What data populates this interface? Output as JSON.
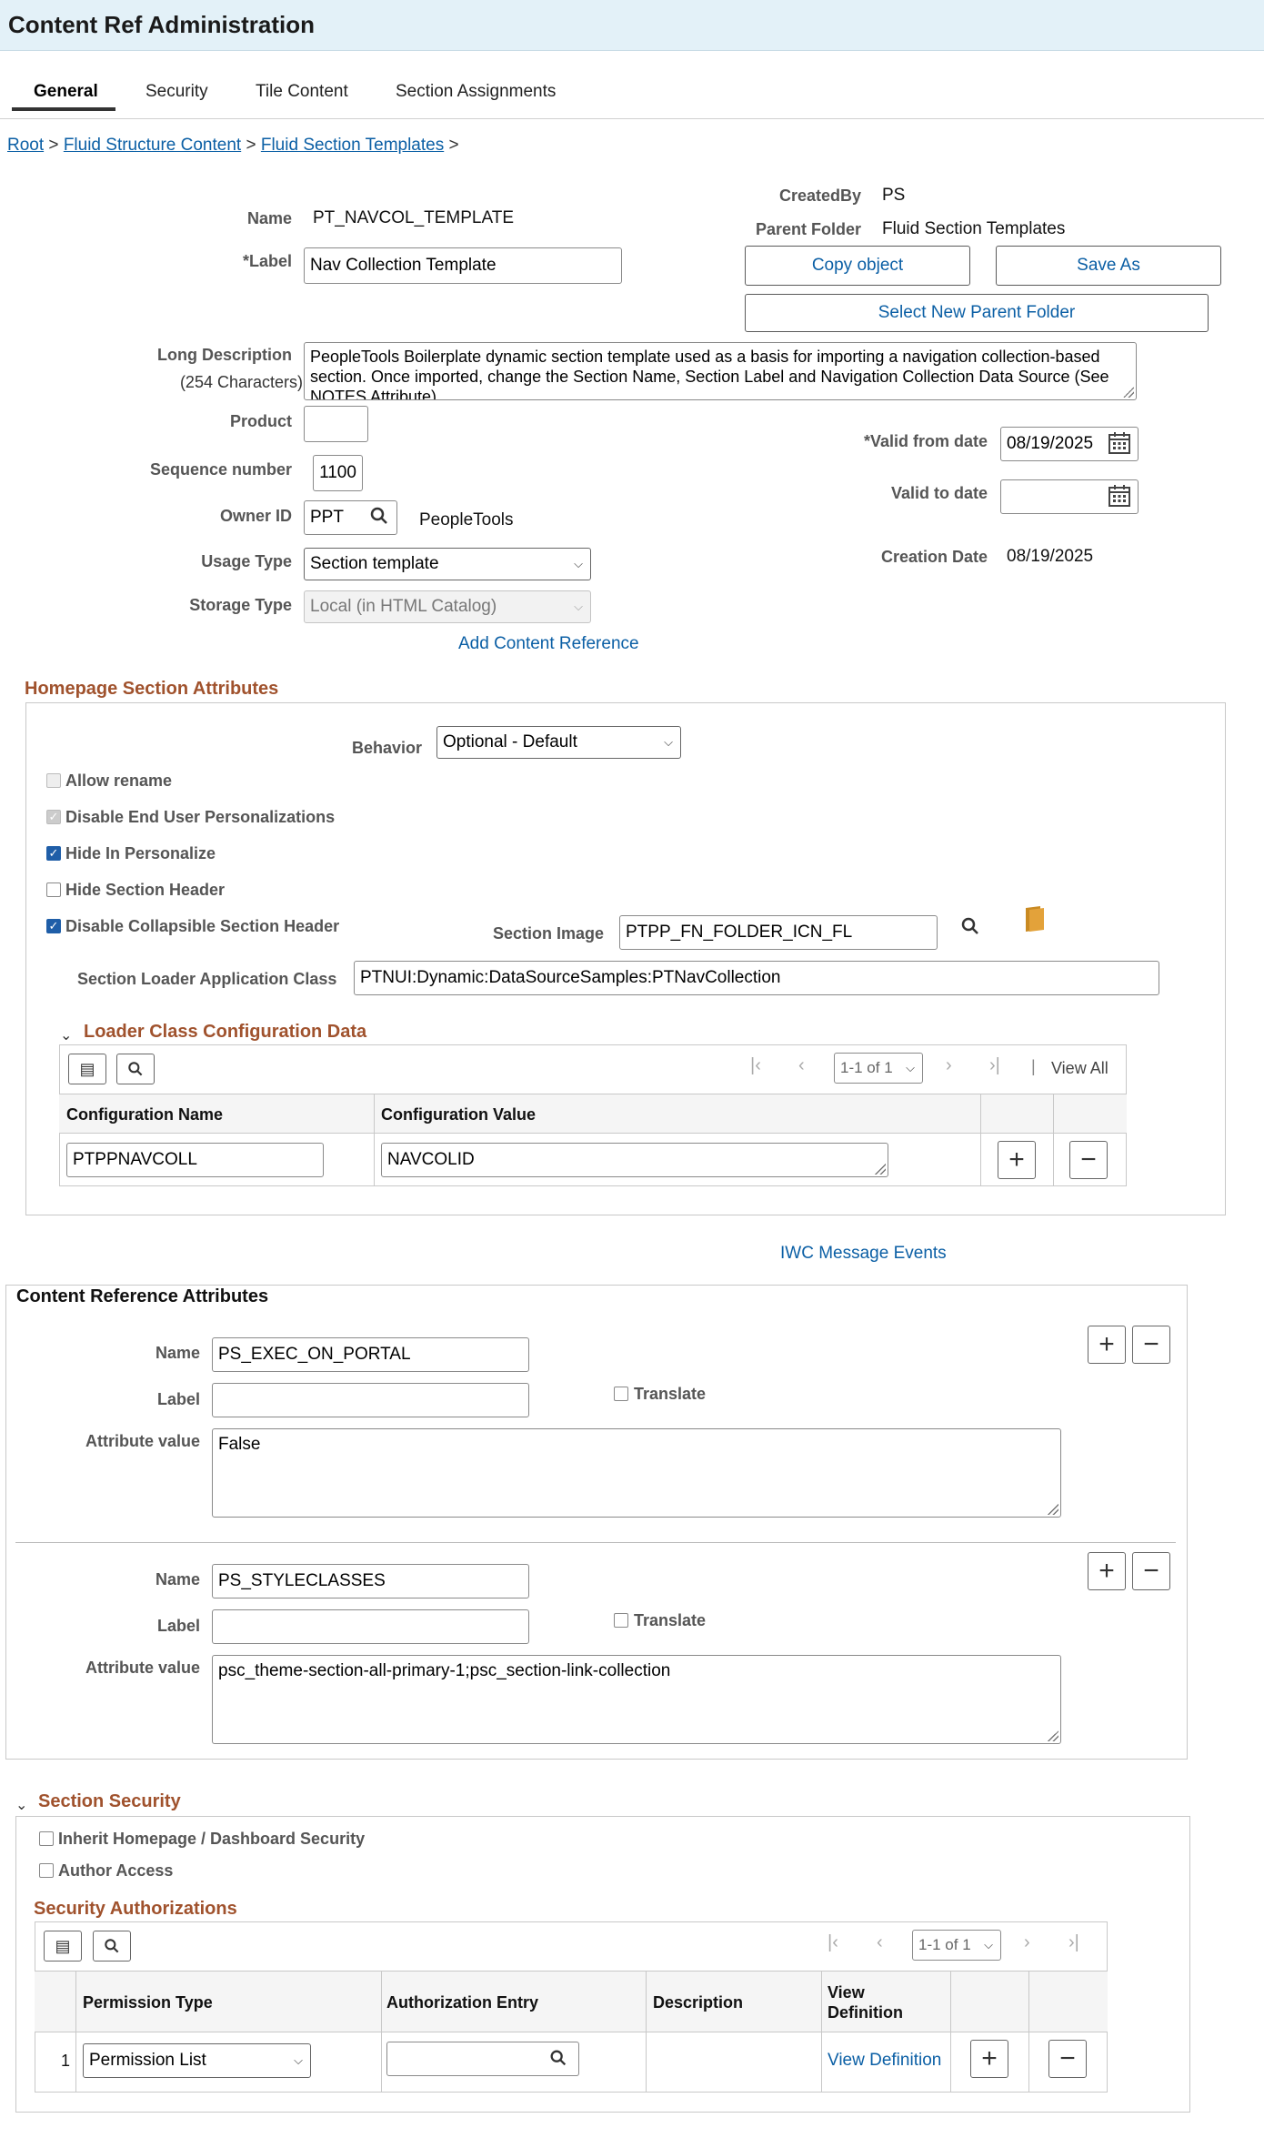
{
  "header": {
    "title": "Content Ref Administration"
  },
  "tabs": [
    {
      "label": "General"
    },
    {
      "label": "Security"
    },
    {
      "label": "Tile Content"
    },
    {
      "label": "Section Assignments"
    }
  ],
  "breadcrumb": {
    "items": [
      "Root",
      "Fluid Structure Content",
      "Fluid Section Templates"
    ],
    "sep": ">"
  },
  "general": {
    "name_label": "Name",
    "name_value": "PT_NAVCOL_TEMPLATE",
    "label_label": "*Label",
    "label_value": "Nav Collection Template",
    "createdby_label": "CreatedBy",
    "createdby_value": "PS",
    "parent_folder_label": "Parent Folder",
    "parent_folder_value": "Fluid Section Templates",
    "copy_object": "Copy object",
    "save_as": "Save As",
    "select_parent": "Select New Parent Folder",
    "long_desc_label": "Long Description",
    "long_desc_sub": "(254 Characters)",
    "long_desc_value": "PeopleTools Boilerplate dynamic section template used as a basis for importing a navigation collection-based section.  Once imported, change the Section Name, Section Label and Navigation Collection Data Source (See NOTES Attribute).",
    "product_label": "Product",
    "product_value": "",
    "seq_label": "Sequence number",
    "seq_value": "1100",
    "owner_label": "Owner ID",
    "owner_value": "PPT",
    "owner_desc": "PeopleTools",
    "usage_label": "Usage Type",
    "usage_value": "Section template",
    "storage_label": "Storage Type",
    "storage_value": "Local (in HTML Catalog)",
    "valid_from_label": "*Valid from date",
    "valid_from_value": "08/19/2025",
    "valid_to_label": "Valid to date",
    "valid_to_value": "",
    "creation_label": "Creation Date",
    "creation_value": "08/19/2025",
    "add_content_ref": "Add Content Reference"
  },
  "homepage": {
    "title": "Homepage Section Attributes",
    "behavior_label": "Behavior",
    "behavior_value": "Optional - Default",
    "checkboxes": [
      {
        "label": "Allow rename",
        "checked": false,
        "disabled": true
      },
      {
        "label": "Disable End User Personalizations",
        "checked": true,
        "disabled": true
      },
      {
        "label": "Hide In Personalize",
        "checked": true,
        "disabled": false
      },
      {
        "label": "Hide Section Header",
        "checked": false,
        "disabled": false
      },
      {
        "label": "Disable Collapsible Section Header",
        "checked": true,
        "disabled": false
      }
    ],
    "section_image_label": "Section Image",
    "section_image_value": "PTPP_FN_FOLDER_ICN_FL",
    "loader_label": "Section Loader Application Class",
    "loader_value": "PTNUI:Dynamic:DataSourceSamples:PTNavCollection",
    "loader_cfg_title": "Loader Class Configuration Data",
    "pager": "1-1 of 1",
    "view_all": "View All",
    "col_name": "Configuration Name",
    "col_value": "Configuration Value",
    "row_name": "PTPPNAVCOLL",
    "row_value": "NAVCOLID"
  },
  "iwc": "IWC Message Events",
  "cra": {
    "title": "Content Reference Attributes",
    "name_label": "Name",
    "label_label": "Label",
    "translate": "Translate",
    "attr_label": "Attribute value",
    "attrs": [
      {
        "name": "PS_EXEC_ON_PORTAL",
        "label": "",
        "value": "False"
      },
      {
        "name": "PS_STYLECLASSES",
        "label": "",
        "value": "psc_theme-section-all-primary-1;psc_section-link-collection"
      }
    ]
  },
  "security": {
    "title": "Section Security",
    "inherit": "Inherit Homepage / Dashboard Security",
    "author": "Author Access",
    "auth_title": "Security Authorizations",
    "pager": "1-1 of 1",
    "col_perm": "Permission Type",
    "col_entry": "Authorization Entry",
    "col_desc": "Description",
    "col_view": "View Definition",
    "row_num": "1",
    "row_perm": "Permission List",
    "row_entry": "",
    "row_desc": "",
    "row_view": "View Definition"
  }
}
